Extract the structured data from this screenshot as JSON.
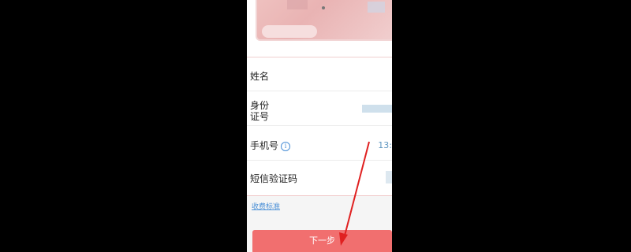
{
  "form": {
    "name_label": "姓名",
    "id_label_line1": "身份",
    "id_label_line2": "证号",
    "phone_label": "手机号",
    "phone_value_partial": "13:",
    "sms_label": "短信验证码"
  },
  "fee_link": "收费标准",
  "next_button": "下一步",
  "colors": {
    "button": "#f16f6f",
    "link": "#4a8fd6",
    "annotation_arrow": "#e02020"
  },
  "icons": {
    "info": "info-icon"
  }
}
